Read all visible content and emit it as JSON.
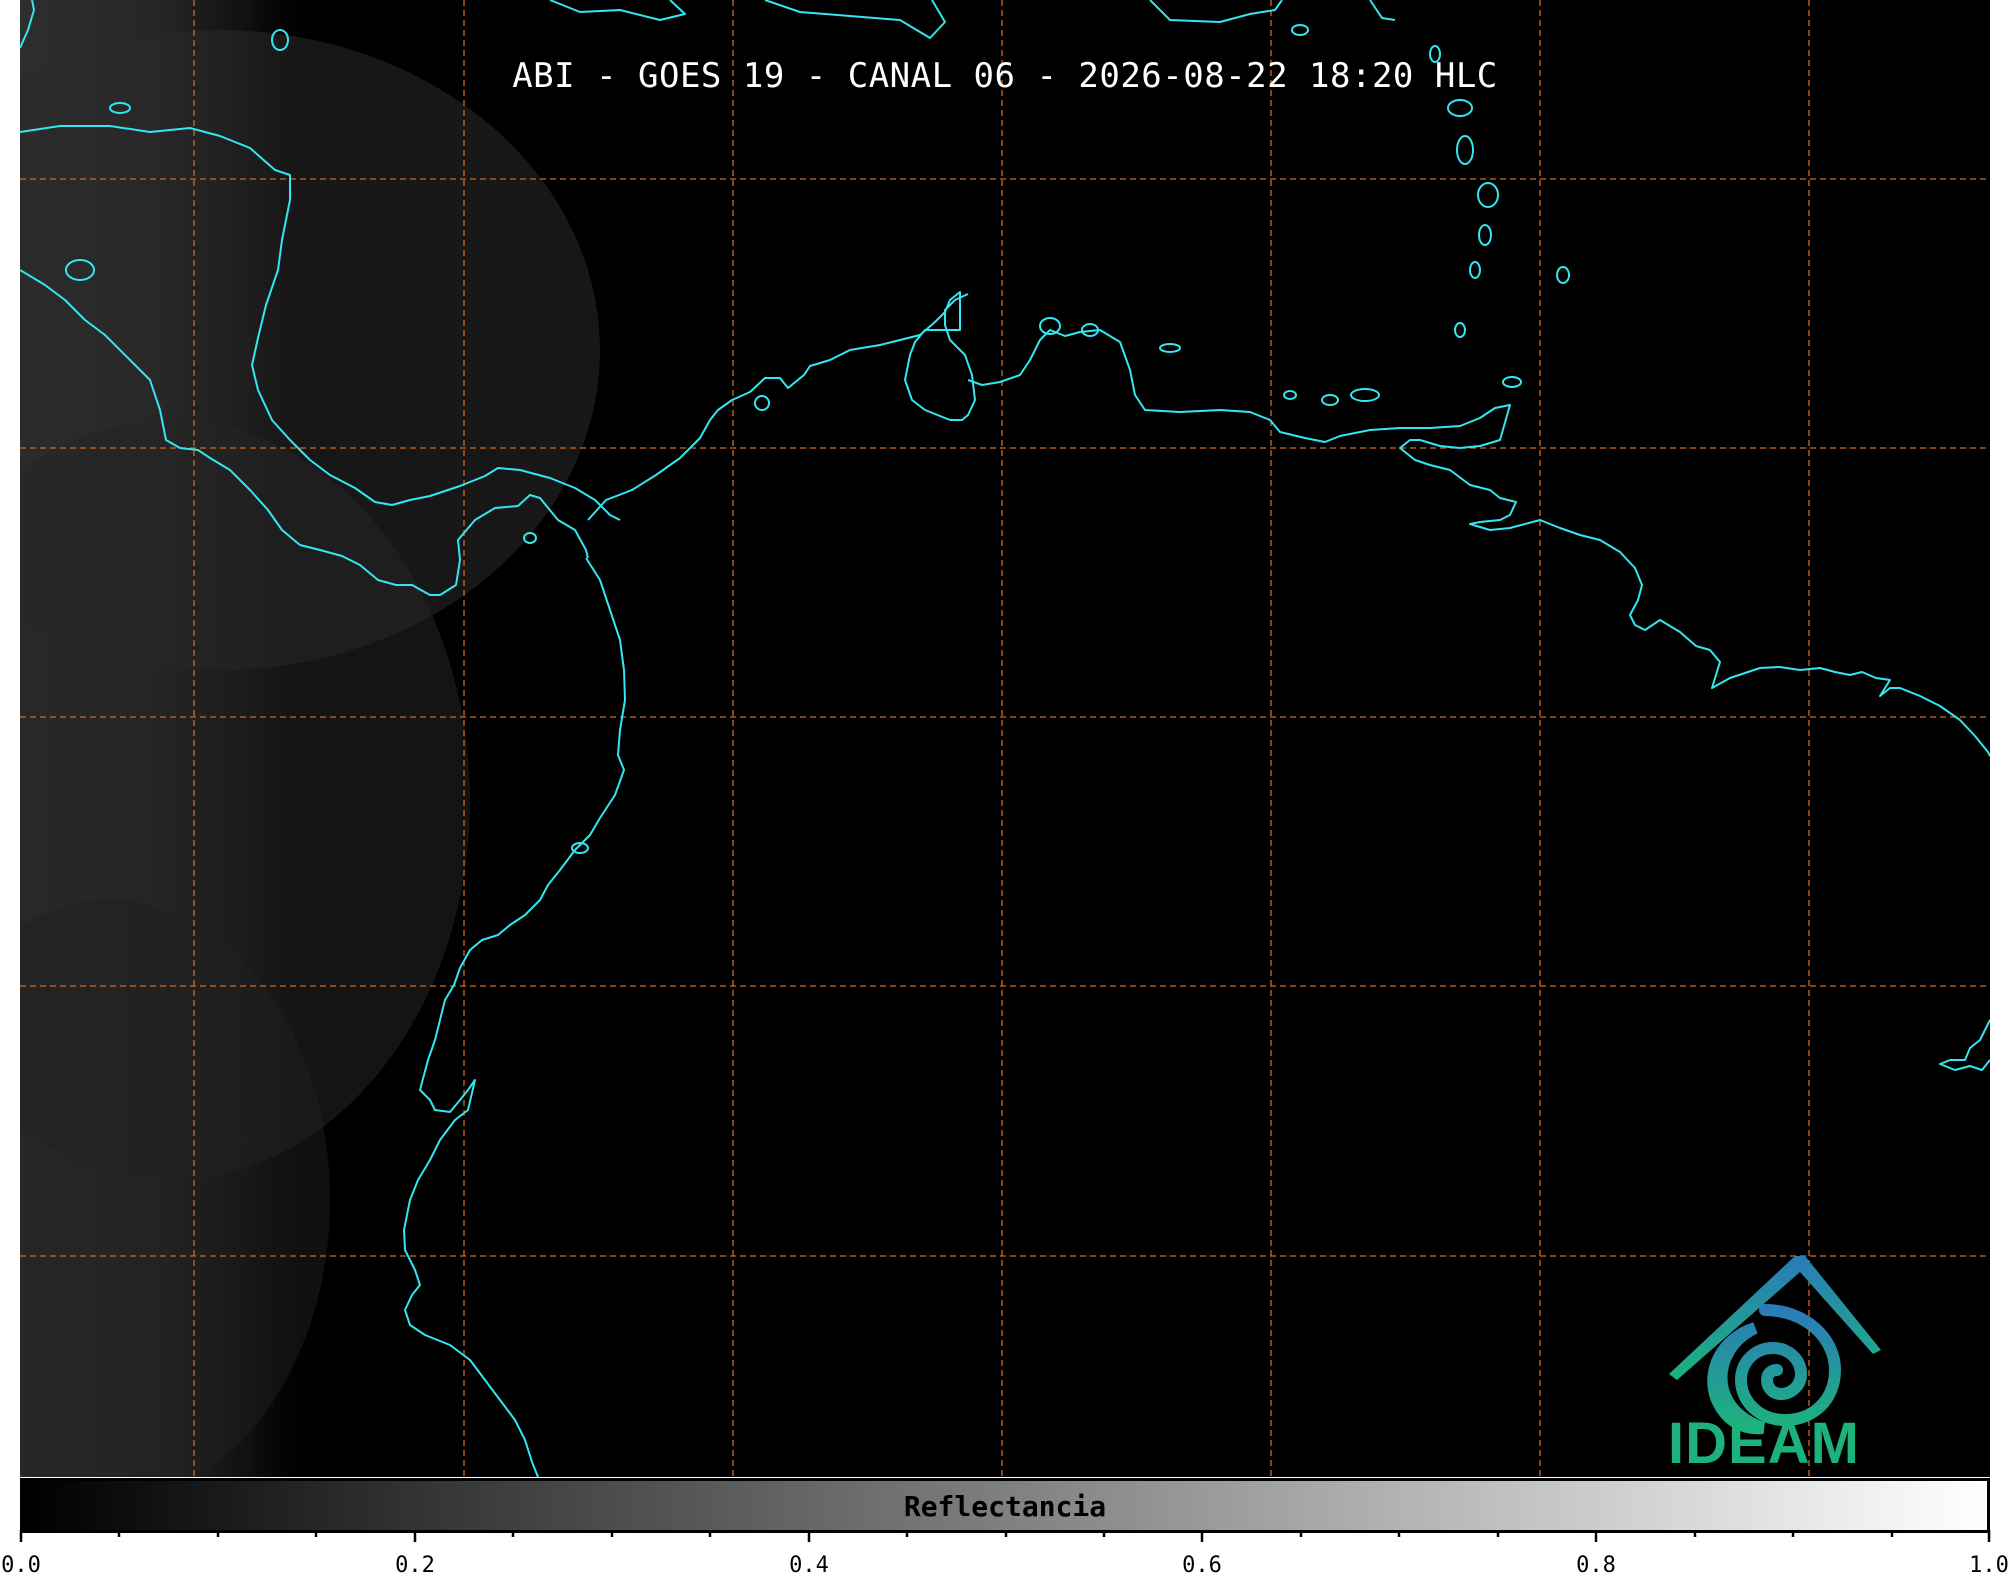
{
  "title": "ABI - GOES 19 - CANAL 06 - 2026-08-22 18:20 HLC",
  "map": {
    "background_color": "#000000",
    "coastline_color": "#33e6f0",
    "grid_color": "#d2691e",
    "grid_style": "dashed"
  },
  "colorbar": {
    "label": "Reflectancia",
    "range": [
      0.0,
      1.0
    ],
    "gradient": [
      "#000000",
      "#ffffff"
    ],
    "major_ticks": [
      "0.0",
      "0.2",
      "0.4",
      "0.6",
      "0.8",
      "1.0"
    ]
  },
  "logo": {
    "text": "IDEAM",
    "icon": "ideam-logo-icon",
    "colors": [
      "#2b7bb9",
      "#1db27c"
    ]
  }
}
